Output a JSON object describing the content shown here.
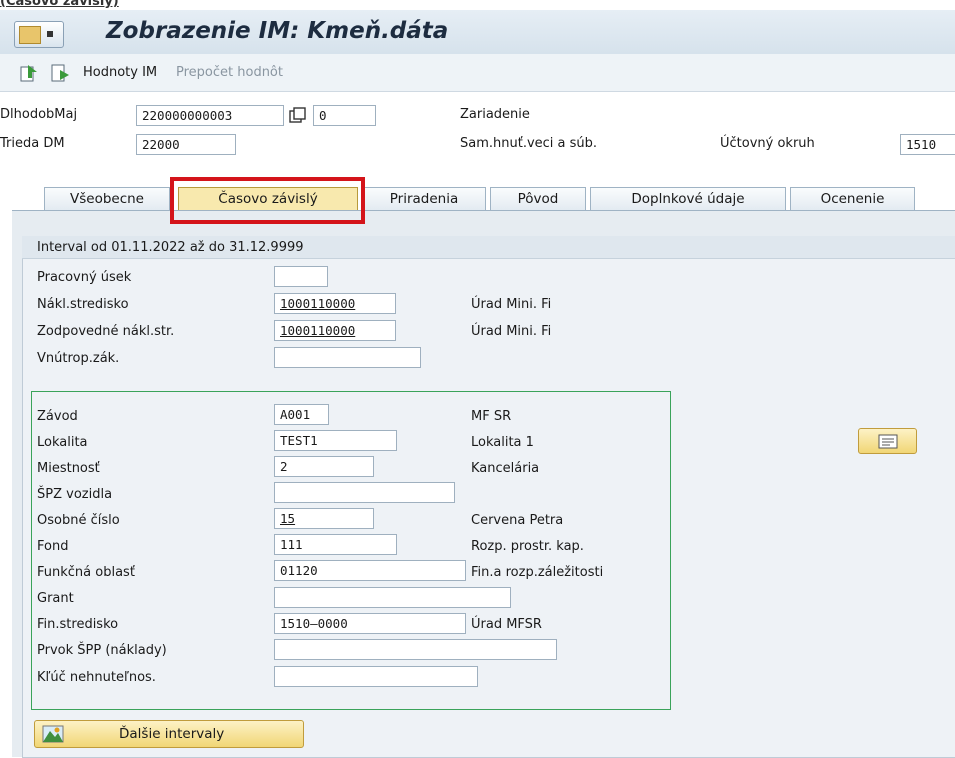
{
  "top_strip_text": "(Časovo závislý)",
  "title": "Zobrazenie IM:  Kmeň.dáta",
  "toolbar": {
    "hodnoty_label": "Hodnoty IM",
    "prepocet_label": "Prepočet hodnôt"
  },
  "header": {
    "asset_label": "DlhodobMaj",
    "asset_value": "220000000003",
    "sub_value": "0",
    "zariadenie_label": "Zariadenie",
    "class_label": "Trieda DM",
    "class_value": "22000",
    "samhnut_label": "Sam.hnuť.veci a súb.",
    "okruh_label": "Účtovný okruh",
    "okruh_value": "1510"
  },
  "tabs": [
    {
      "label": "Všeobecne"
    },
    {
      "label": "Časovo závislý"
    },
    {
      "label": "Priradenia"
    },
    {
      "label": "Pôvod"
    },
    {
      "label": "Doplnkové údaje"
    },
    {
      "label": "Ocenenie"
    }
  ],
  "interval_title": "Interval od 01.11.2022 až do 31.12.9999",
  "fields_top": [
    {
      "label": "Pracovný úsek",
      "value": "",
      "desc": ""
    },
    {
      "label": "Nákl.stredisko",
      "value": "1000110000",
      "desc": "Úrad Mini. Fi"
    },
    {
      "label": "Zodpovedné nákl.str.",
      "value": "1000110000",
      "desc": "Úrad Mini. Fi"
    },
    {
      "label": "Vnútrop.zák.",
      "value": "",
      "desc": ""
    }
  ],
  "fields_bottom": [
    {
      "label": "Závod",
      "value": "A001",
      "desc": "MF SR"
    },
    {
      "label": "Lokalita",
      "value": "TEST1",
      "desc": "Lokalita 1"
    },
    {
      "label": "Miestnosť",
      "value": "2",
      "desc": "Kancelária"
    },
    {
      "label": "ŠPZ vozidla",
      "value": "",
      "desc": ""
    },
    {
      "label": "Osobné číslo",
      "value": "15",
      "desc": "Cervena Petra"
    },
    {
      "label": "Fond",
      "value": "111",
      "desc": "Rozp. prostr. kap."
    },
    {
      "label": "Funkčná oblasť",
      "value": "01120",
      "desc": "Fin.a rozp.záležitosti"
    },
    {
      "label": "Grant",
      "value": "",
      "desc": ""
    },
    {
      "label": "Fin.stredisko",
      "value": "1510–0000",
      "desc": "Úrad MFSR"
    },
    {
      "label": "Prvok ŠPP (náklady)",
      "value": "",
      "desc": ""
    },
    {
      "label": "Kľúč nehnuteľnos.",
      "value": "",
      "desc": ""
    }
  ],
  "next_intervals_label": "Ďalšie intervaly"
}
